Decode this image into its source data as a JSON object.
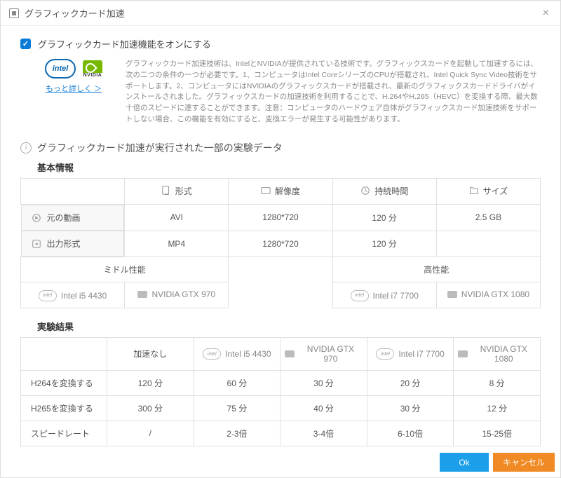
{
  "titlebar": {
    "title": "グラフィックカード加速"
  },
  "checkbox": {
    "label": "グラフィックカード加速機能をオンにする",
    "checked": true
  },
  "logos": {
    "intel": "intel",
    "nvidia": "NVIDIA"
  },
  "more_link": "もっと詳しく ＞",
  "description": "グラフィックカード加速技術は、IntelとNVIDIAが提供されている技術です。グラフィックスカードを起動して加速するには、次の二つの条件の一つが必要です。1、コンピュータはIntel CoreシリーズのCPUが搭載され、Intel Quick Sync Video技術をサポートします。2、コンピュータにはNVIDIAのグラフィックスカードが搭載され、最新のグラフィックスカードドライバがインストールされました。グラフィックスカードの加速技術を利用することで、H.264やH.265（HEVC）を変換する際、最大数十倍のスピードに達することができます。注意：コンピュータのハードウェア自体がグラフィックスカード加速技術をサポートしない場合、この機能を有効にすると、変換エラーが発生する可能性があります。",
  "section_title": "グラフィックカード加速が実行された一部の実験データ",
  "basic": {
    "heading": "基本情報",
    "headers": {
      "blank": "",
      "format": "形式",
      "resolution": "解像度",
      "duration": "持続時間",
      "size": "サイズ"
    },
    "rows": [
      {
        "label": "元の動画",
        "format": "AVI",
        "resolution": "1280*720",
        "duration": "120 分",
        "size": "2.5 GB"
      },
      {
        "label": "出力形式",
        "format": "MP4",
        "resolution": "1280*720",
        "duration": "120 分",
        "size": ""
      }
    ]
  },
  "perf": {
    "mid_label": "ミドル性能",
    "high_label": "高性能",
    "mid": {
      "cpu": "Intel i5 4430",
      "gpu": "NVIDIA GTX 970"
    },
    "high": {
      "cpu": "Intel i7 7700",
      "gpu": "NVIDIA GTX 1080"
    }
  },
  "results": {
    "heading": "実験結果",
    "headers": {
      "blank": "",
      "none": "加速なし",
      "i5": "Intel i5 4430",
      "gtx970": "NVIDIA GTX 970",
      "i7": "Intel i7 7700",
      "gtx1080": "NVIDIA GTX 1080"
    },
    "rows": [
      {
        "label": "H264を変換する",
        "none": "120 分",
        "i5": "60 分",
        "gtx970": "30 分",
        "i7": "20 分",
        "gtx1080": "8 分"
      },
      {
        "label": "H265を変換する",
        "none": "300 分",
        "i5": "75 分",
        "gtx970": "40 分",
        "i7": "30 分",
        "gtx1080": "12 分"
      },
      {
        "label": "スピードレート",
        "none": "/",
        "i5": "2-3倍",
        "gtx970": "3-4倍",
        "i7": "6-10倍",
        "gtx1080": "15-25倍"
      }
    ]
  },
  "buttons": {
    "ok": "Ok",
    "cancel": "キャンセル"
  }
}
